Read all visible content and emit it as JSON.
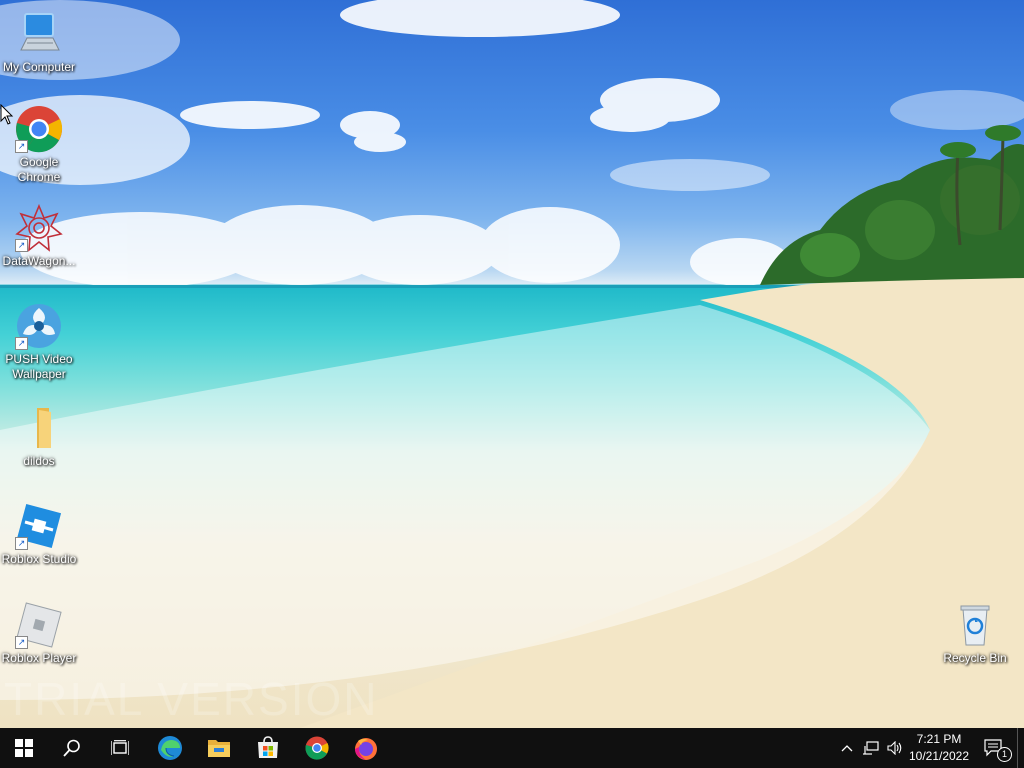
{
  "desktop": {
    "watermark": "TRIAL VERSION",
    "icons": [
      {
        "label": "My Computer",
        "icon": "computer-icon"
      },
      {
        "label": "Google Chrome",
        "icon": "chrome-icon"
      },
      {
        "label": "DataWagon...",
        "icon": "datawagon-icon"
      },
      {
        "label": "PUSH Video Wallpaper",
        "icon": "push-video-wallpaper-icon"
      },
      {
        "label": "dildos",
        "icon": "folder-icon"
      },
      {
        "label": "Roblox Studio",
        "icon": "roblox-studio-icon"
      },
      {
        "label": "Roblox Player",
        "icon": "roblox-player-icon"
      },
      {
        "label": "Recycle Bin",
        "icon": "recycle-bin-icon"
      }
    ]
  },
  "taskbar": {
    "buttons": [
      "start-icon",
      "search-icon",
      "task-view-icon",
      "edge-icon",
      "file-explorer-icon",
      "microsoft-store-icon",
      "chrome-icon",
      "firefox-icon"
    ],
    "clock": {
      "time": "7:21 PM",
      "date": "10/21/2022"
    },
    "notifications": {
      "count": "1"
    }
  }
}
